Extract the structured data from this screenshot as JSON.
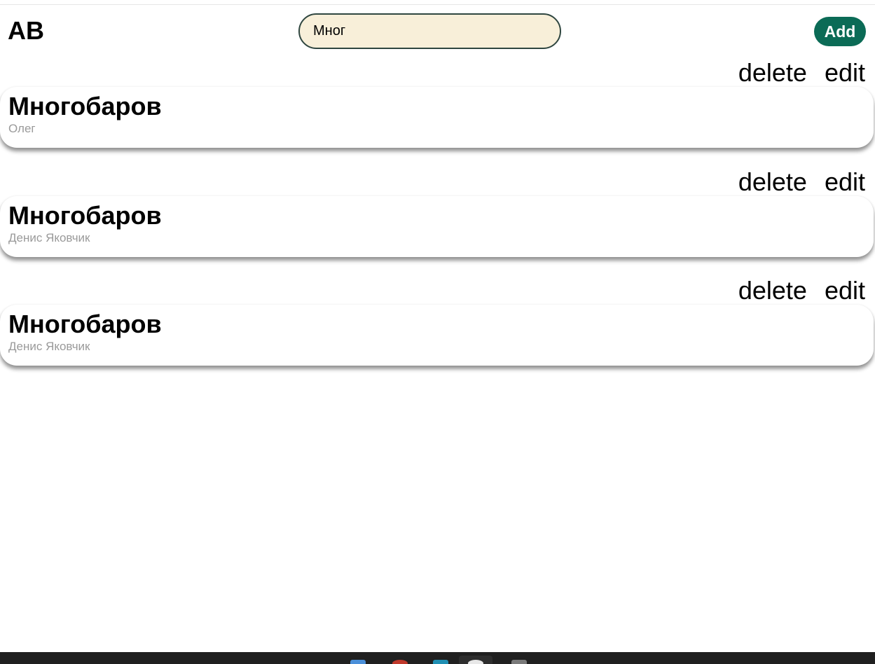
{
  "header": {
    "title": "AB",
    "search_value": "Мног",
    "add_label": "Add"
  },
  "entries": [
    {
      "title": "Многобаров",
      "subtitle": "Олег",
      "delete_label": "delete",
      "edit_label": "edit"
    },
    {
      "title": "Многобаров",
      "subtitle": "Денис Яковчик",
      "delete_label": "delete",
      "edit_label": "edit"
    },
    {
      "title": "Многобаров",
      "subtitle": "Денис Яковчик",
      "delete_label": "delete",
      "edit_label": "edit"
    }
  ],
  "colors": {
    "accent": "#0b6b56",
    "search_background": "#f8efd9",
    "search_border": "#2f4640",
    "subtitle": "#9a9a9a",
    "taskbar": "#202020"
  },
  "taskbar": {
    "icons": [
      "windows-start-icon",
      "app-icon",
      "edge-icon",
      "chrome-icon",
      "file-explorer-icon"
    ]
  }
}
